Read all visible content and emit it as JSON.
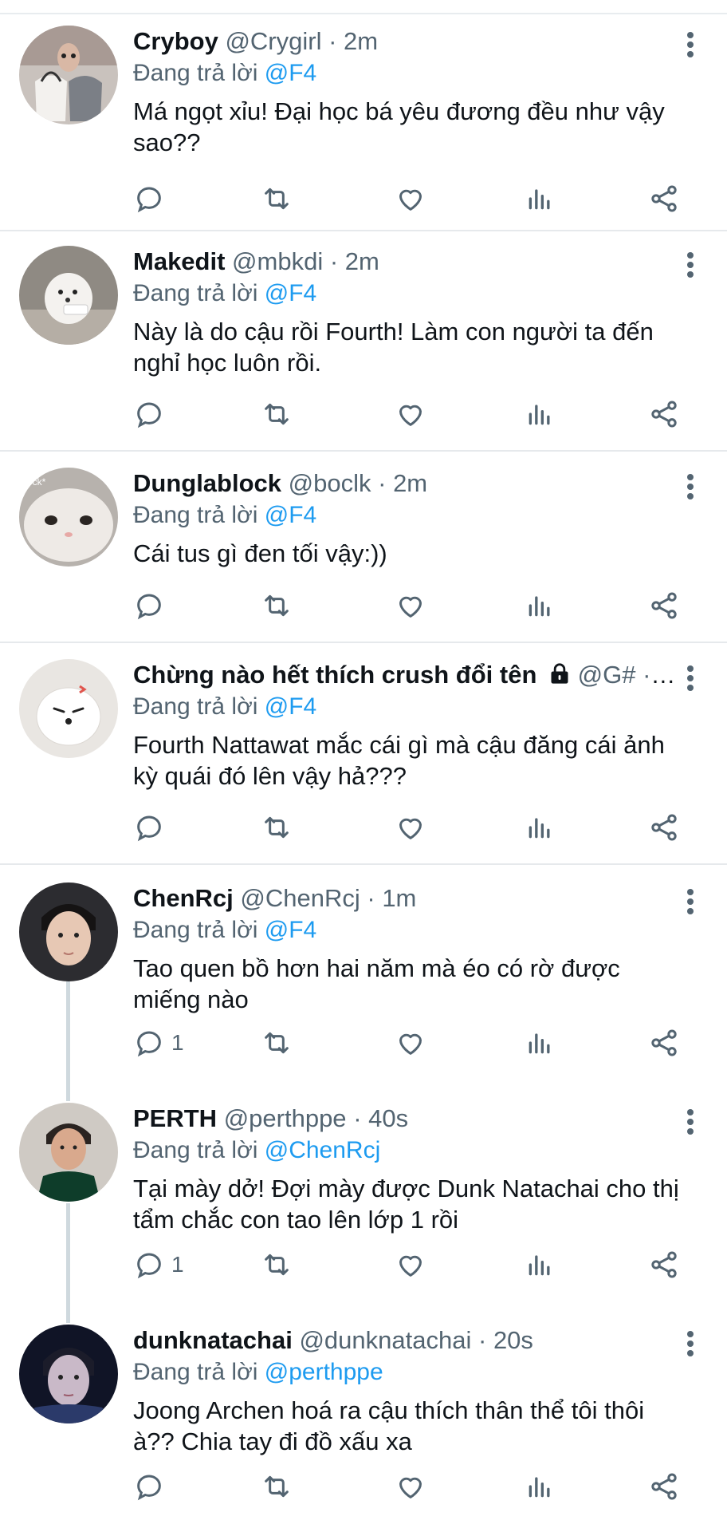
{
  "reply_prefix": "Đang trả lời",
  "tweets": [
    {
      "name": "Cryboy",
      "handle": "@Crygirl",
      "time": "2m",
      "reply_to": "@F4",
      "text": "Má ngọt xỉu! Đại học bá yêu đương đều như vậy sao??",
      "reply_count": "",
      "avatar_icon": "avatar-bag"
    },
    {
      "name": "Makedit",
      "handle": "@mbkdi",
      "time": "2m",
      "reply_to": "@F4",
      "text": "Này là do cậu rồi Fourth! Làm con người ta đến nghỉ học luôn rồi.",
      "reply_count": "",
      "avatar_icon": "avatar-white-puppy"
    },
    {
      "name": "Dunglablock",
      "handle": "@boclk",
      "time": "2m",
      "reply_to": "@F4",
      "text": "Cái tus gì đen tối vậy:))",
      "reply_count": "",
      "avatar_icon": "avatar-white-cat",
      "avatar_text": "ock*"
    },
    {
      "name": "Chừng nào hết thích crush đổi tên",
      "handle": "@G#",
      "time": "…",
      "reply_to": "@F4",
      "text": "Fourth Nattawat mắc cái gì mà cậu đăng cái ảnh kỳ quái đó lên vậy hả???",
      "reply_count": "",
      "avatar_icon": "avatar-angry-dog"
    },
    {
      "name": "ChenRcj",
      "handle": "@ChenRcj",
      "time": "1m",
      "reply_to": "@F4",
      "text": "Tao quen bồ hơn hai năm mà éo có rờ được miếng nào",
      "reply_count": "1",
      "avatar_icon": "avatar-man-portrait"
    },
    {
      "name": "PERTH",
      "handle": "@perthppe",
      "time": "40s",
      "reply_to": "@ChenRcj",
      "text": "Tại mày dở! Đợi mày được Dunk Natachai cho thị tẩm chắc con tao lên lớp 1 rồi",
      "reply_count": "1",
      "avatar_icon": "avatar-man-tank-top"
    },
    {
      "name": "dunknatachai",
      "handle": "@dunknatachai",
      "time": "20s",
      "reply_to": "@perthppe",
      "text": "Joong Archen hoá ra cậu thích thân thể tôi thôi à?? Chia tay đi đồ xấu xa",
      "reply_count": "",
      "avatar_icon": "avatar-man-dark"
    }
  ],
  "colors": {
    "mention": "#1d9bf0",
    "secondary": "#536471",
    "divider": "#e6e9ec"
  }
}
